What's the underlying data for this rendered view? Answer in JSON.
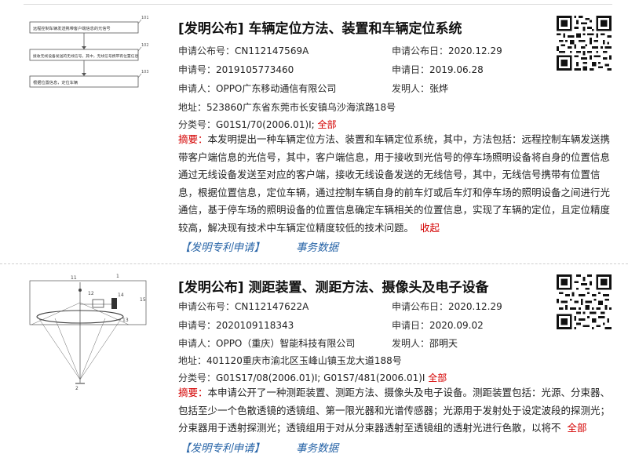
{
  "records": [
    {
      "title": "[发明公布] 车辆定位方法、装置和车辆定位系统",
      "pub_no_label": "申请公布号：",
      "pub_no": "CN112147569A",
      "pub_date_label": "申请公布日：",
      "pub_date": "2020.12.29",
      "app_no_label": "申请号：",
      "app_no": "2019105773460",
      "app_date_label": "申请日：",
      "app_date": "2019.06.28",
      "applicant_label": "申请人：",
      "applicant": "OPPO广东移动通信有限公司",
      "inventor_label": "发明人：",
      "inventor": "张烨",
      "address_label": "地址：",
      "address": "523860广东省东莞市长安镇乌沙海滨路18号",
      "class_label": "分类号：",
      "class": "G01S1/70(2006.01)I;",
      "class_all": "全部",
      "abstract_label": "摘要：",
      "abstract": "本发明提出一种车辆定位方法、装置和车辆定位系统，其中，方法包括：远程控制车辆发送携带客户端信息的光信号，其中，客户端信息，用于接收到光信号的停车场照明设备将自身的位置信息通过无线设备发送至对应的客户端，接收无线设备发送的无线信号，其中，无线信号携带有位置信息，根据位置信息，定位车辆，通过控制车辆自身的前车灯或后车灯和停车场的照明设备之间进行光通信，基于停车场的照明设备的位置信息确定车辆相关的位置信息，实现了车辆的定位，且定位精度较高，解决现有技术中车辆定位精度较低的技术问题。",
      "abstract_toggle": "收起",
      "link1": "【发明专利申请】",
      "link2": "事务数据",
      "figure_text": [
        "远程控制车辆发送携带客户端信息的光信号",
        "接收无线设备发送的无线信号，其中，无线信号携带有位置信息",
        "根据位置信息，定位车辆"
      ],
      "figure_refs": [
        "101",
        "102",
        "103"
      ]
    },
    {
      "title": "[发明公布] 测距装置、测距方法、摄像头及电子设备",
      "pub_no_label": "申请公布号：",
      "pub_no": "CN112147622A",
      "pub_date_label": "申请公布日：",
      "pub_date": "2020.12.29",
      "app_no_label": "申请号：",
      "app_no": "2020109118343",
      "app_date_label": "申请日：",
      "app_date": "2020.09.02",
      "applicant_label": "申请人：",
      "applicant": "OPPO（重庆）智能科技有限公司",
      "inventor_label": "发明人：",
      "inventor": "邵明天",
      "address_label": "地址：",
      "address": "401120重庆市渝北区玉峰山镇玉龙大道188号",
      "class_label": "分类号：",
      "class": "G01S17/08(2006.01)I; G01S7/481(2006.01)I",
      "class_all": "全部",
      "abstract_label": "摘要：",
      "abstract": "本申请公开了一种测距装置、测距方法、摄像头及电子设备。测距装置包括：光源、分束器、包括至少一个色散透镜的透镜组、第一限光器和光谱传感器；光源用于发射处于设定波段的探测光；分束器用于透射探测光；透镜组用于对从分束器透射至透镜组的透射光进行色散，以将不",
      "abstract_toggle": "全部",
      "link1": "【发明专利申请】",
      "link2": "事务数据",
      "figure_refs": [
        "11",
        "1",
        "12",
        "14",
        "15",
        "13",
        "2"
      ]
    }
  ]
}
